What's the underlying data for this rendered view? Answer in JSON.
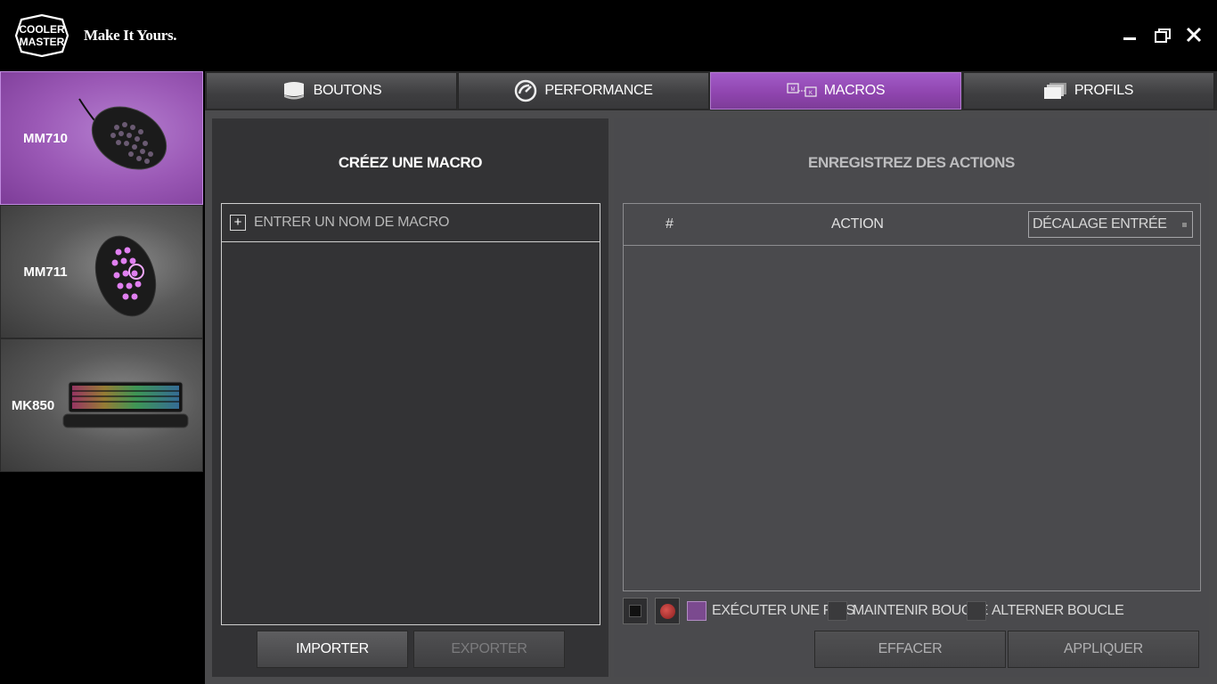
{
  "app": {
    "brand": "COOLER MASTER",
    "tagline": "Make It Yours."
  },
  "window_controls": [
    "minimize-icon",
    "restore-icon",
    "close-icon"
  ],
  "colors": {
    "accent": "#9b59b6",
    "background": "#000000",
    "panel": "#4b4b4d"
  },
  "sidebar": {
    "devices": [
      {
        "label": "MM710",
        "active": true
      },
      {
        "label": "MM711",
        "active": false
      },
      {
        "label": "MK850",
        "active": false
      }
    ]
  },
  "tabs": [
    {
      "label": "BOUTONS",
      "icon": "mouse-icon",
      "active": false
    },
    {
      "label": "PERFORMANCE",
      "icon": "gauge-icon",
      "active": false
    },
    {
      "label": "MACROS",
      "icon": "macro-keys-icon",
      "active": true
    },
    {
      "label": "PROFILS",
      "icon": "profiles-stack-icon",
      "active": false
    }
  ],
  "macro_panel": {
    "title": "CRÉEZ UNE MACRO",
    "add_icon": "+",
    "name_placeholder": "ENTRER UN NOM DE MACRO",
    "import_label": "IMPORTER",
    "export_label": "EXPORTER"
  },
  "actions_panel": {
    "title": "ENREGISTREZ DES ACTIONS",
    "col_number": "#",
    "col_action": "ACTION",
    "delay_select": "DÉCALAGE ENTRÉE",
    "options": [
      {
        "label": "EXÉCUTER UNE FOIS",
        "checked": true
      },
      {
        "label": "MAINTENIR BOUCLE",
        "checked": false
      },
      {
        "label": "ALTERNER BOUCLE",
        "checked": false
      }
    ],
    "clear_label": "EFFACER",
    "apply_label": "APPLIQUER"
  }
}
